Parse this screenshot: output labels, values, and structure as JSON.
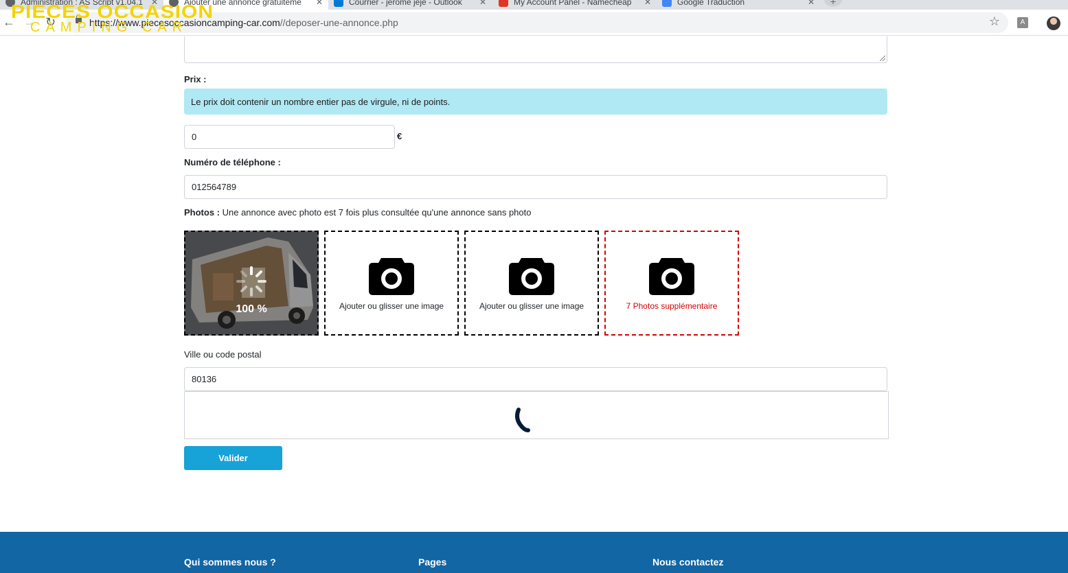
{
  "browser": {
    "tabs": [
      {
        "title": "Administration : AS Script v1.04.1",
        "color": "#5f6368"
      },
      {
        "title": "Ajouter une annonce gratuiteme",
        "color": "#5f6368"
      },
      {
        "title": "Courrier - jerome jeje - Outlook",
        "color": "#0078d4"
      },
      {
        "title": "My Account Panel - Namecheap",
        "color": "#de3723"
      },
      {
        "title": "Google Traduction",
        "color": "#4285f4"
      }
    ],
    "new_tab": "+",
    "url_host": "https://www.piecesoccasioncamping-car.com",
    "url_path": "//deposer-une-annonce.php",
    "pdf_ext": "A"
  },
  "logo": {
    "line1": "PIECES OCCASION",
    "line2": "CAMPING CAR",
    "color": "#f2d500"
  },
  "form": {
    "price_label": "Prix :",
    "price_alert": "Le prix doit contenir un nombre entier pas de virgule, ni de points.",
    "price_value": "0",
    "currency": "€",
    "phone_label": "Numéro de téléphone :",
    "phone_value": "012564789",
    "photos_label": "Photos :",
    "photos_hint": " Une annonce avec photo est 7 fois plus consultée qu'une annonce sans photo",
    "photo_slots": [
      {
        "type": "preview",
        "progress": "100 %"
      },
      {
        "type": "empty",
        "caption": "Ajouter ou glisser une image"
      },
      {
        "type": "empty",
        "caption": "Ajouter ou glisser une image"
      },
      {
        "type": "more",
        "caption": "7 Photos supplémentaire"
      }
    ],
    "city_label": "Ville ou code postal",
    "city_value": "80136",
    "submit_label": "Valider"
  },
  "footer": {
    "col1": "Qui sommes nous ?",
    "col2": "Pages",
    "col3": "Nous contactez"
  },
  "colors": {
    "alert_bg": "#b0e8f3",
    "submit_bg": "#17a2d8",
    "footer_bg": "#1266a3",
    "red_slot": "#d40000"
  }
}
